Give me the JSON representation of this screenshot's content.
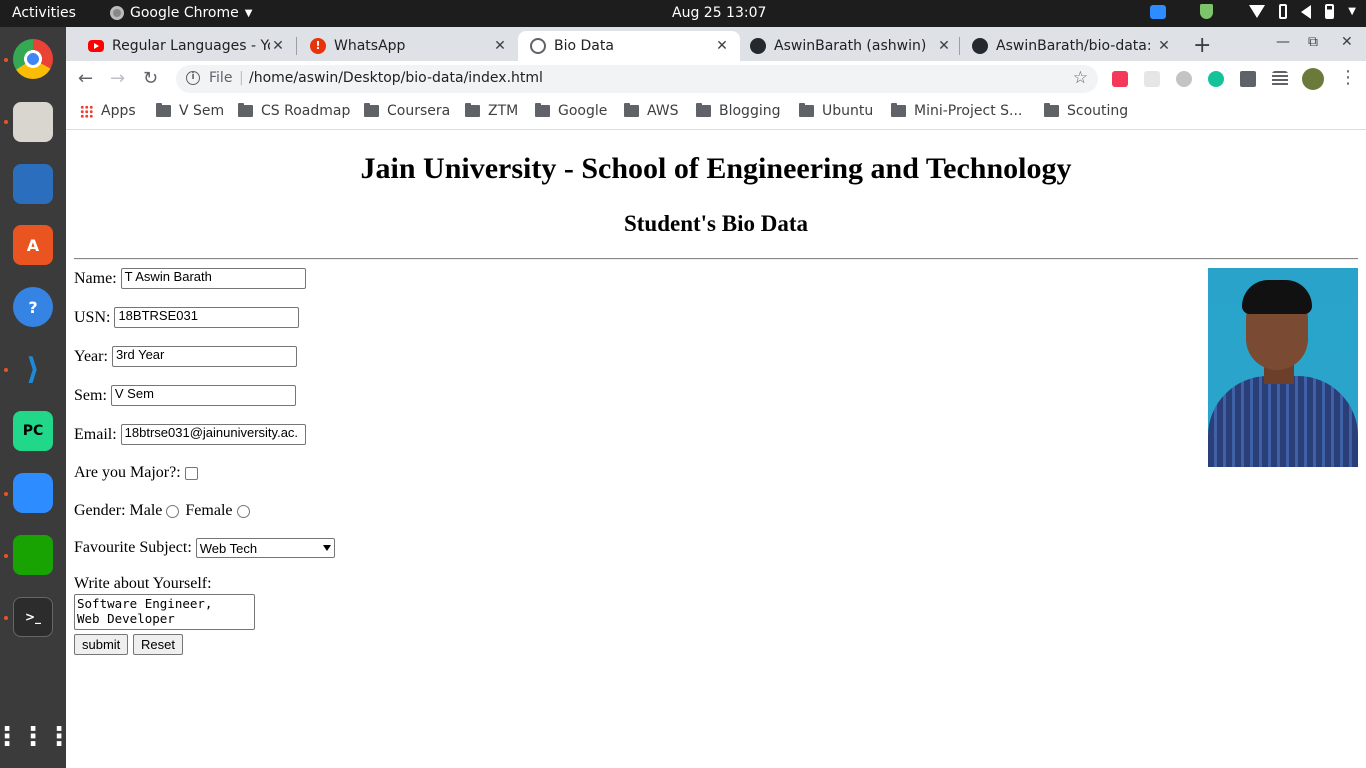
{
  "topbar": {
    "activities": "Activities",
    "app_name": "Google Chrome",
    "clock": "Aug 25  13:07"
  },
  "tabs": [
    {
      "title": "Regular Languages - Yo",
      "favicon": "youtube-icon",
      "active": false
    },
    {
      "title": "WhatsApp",
      "favicon": "whatsapp-icon",
      "active": false
    },
    {
      "title": "Bio Data",
      "favicon": "globe-icon",
      "active": true
    },
    {
      "title": "AswinBarath (ashwin)",
      "favicon": "github-icon",
      "active": false
    },
    {
      "title": "AswinBarath/bio-data:",
      "favicon": "github-icon",
      "active": false
    }
  ],
  "omnibox": {
    "scheme": "File",
    "url": "/home/aswin/Desktop/bio-data/index.html"
  },
  "bookmarks": [
    {
      "label": "Apps",
      "icon": "apps-grid-icon"
    },
    {
      "label": "V Sem",
      "icon": "folder-icon"
    },
    {
      "label": "CS Roadmap",
      "icon": "folder-icon"
    },
    {
      "label": "Coursera",
      "icon": "folder-icon"
    },
    {
      "label": "ZTM",
      "icon": "folder-icon"
    },
    {
      "label": "Google",
      "icon": "folder-icon"
    },
    {
      "label": "AWS",
      "icon": "folder-icon"
    },
    {
      "label": "Blogging",
      "icon": "folder-icon"
    },
    {
      "label": "Ubuntu",
      "icon": "folder-icon"
    },
    {
      "label": "Mini-Project S...",
      "icon": "folder-icon"
    },
    {
      "label": "Scouting",
      "icon": "folder-icon"
    }
  ],
  "page": {
    "title": "Jain University - School of Engineering and Technology",
    "subtitle": "Student's Bio Data",
    "form": {
      "name_label": "Name:",
      "name_value": "T Aswin Barath",
      "usn_label": "USN:",
      "usn_value": "18BTRSE031",
      "year_label": "Year:",
      "year_value": "3rd Year",
      "sem_label": "Sem:",
      "sem_value": "V Sem",
      "email_label": "Email:",
      "email_value": "18btrse031@jainuniversity.ac.",
      "major_label": "Are you Major?:",
      "major_checked": false,
      "gender_label": "Gender:",
      "gender_male": "Male",
      "gender_female": "Female",
      "subject_label": "Favourite Subject:",
      "subject_value": "Web Tech",
      "about_label": "Write about Yourself:",
      "about_line1": "Software Engineer,",
      "about_line2": "Web Developer",
      "submit_label": "submit",
      "reset_label": "Reset"
    }
  },
  "colors": {
    "topbar": "#1d1d1d",
    "dock": "#3b3b3b",
    "tabstrip": "#dee1e6",
    "accent_orange": "#e95420"
  }
}
